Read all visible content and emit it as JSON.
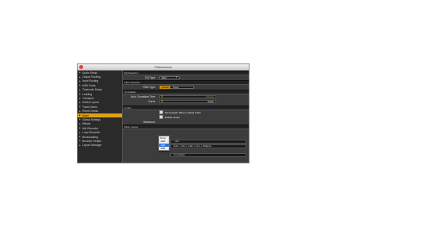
{
  "window": {
    "title": "Preferences"
  },
  "sidebar": {
    "items": [
      {
        "label": "Audio Setup",
        "active": false
      },
      {
        "label": "Output Routing",
        "active": false
      },
      {
        "label": "Input Routing",
        "active": false
      },
      {
        "label": "MIDI Fonts",
        "active": false
      },
      {
        "label": "Timecode Setup",
        "active": false
      },
      {
        "label": "Loading",
        "active": false
      },
      {
        "label": "Transport",
        "active": false
      },
      {
        "label": "Decks Layout",
        "active": false
      },
      {
        "label": "Track Decks",
        "active": false
      },
      {
        "label": "Remix Decks",
        "active": false
      },
      {
        "label": "Mixer",
        "active": true
      },
      {
        "label": "Global Settings",
        "active": false
      },
      {
        "label": "Effects",
        "active": false
      },
      {
        "label": "Mix Recorder",
        "active": false
      },
      {
        "label": "Loop Recorder",
        "active": false
      },
      {
        "label": "Broadcasting",
        "active": false
      },
      {
        "label": "Browser Details",
        "active": false
      },
      {
        "label": "Layout Manager",
        "active": false
      }
    ]
  },
  "mixer": {
    "eq_section": "EQ Selection",
    "eq_type_label": "EQ Type",
    "eq_type_value": "NEO",
    "filter_section": "Filter Selection",
    "filter_type_label": "Filter Type",
    "filter_options": [
      "Ladder",
      "Xone"
    ],
    "filter_selected": "Ladder",
    "crossfader_section": "Crossfader",
    "auto_time_label": "Auto Crossfade Time",
    "auto_time_value": "8.0 sec",
    "curve_label": "Curve",
    "curve_value": "Sharp",
    "limiter_section": "Limiter",
    "opt_autogain": "Set Autogain When Loading Track",
    "opt_limiter": "Enable Limiter",
    "headroom_label": "Headroom",
    "mixer_layout_label": "Mixer Layout",
    "layout_opt1": "...der",
    "layout_opt2": "Gain + Pan + Gain + Cue + Balance",
    "layout_opt3": "Crossfader"
  },
  "dropdown": {
    "items": [
      "None",
      "-3dB",
      "-6dB",
      "-9dB"
    ],
    "selected": "-6dB"
  },
  "colors": {
    "accent": "#e0a010",
    "close": "#e0443e"
  }
}
